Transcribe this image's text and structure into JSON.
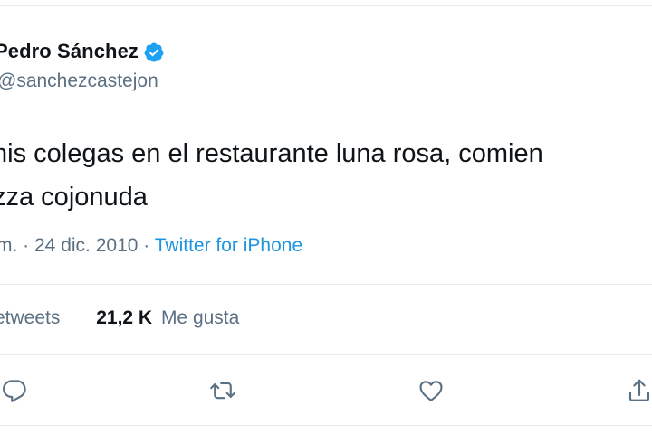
{
  "author": {
    "display_name": "Pedro Sánchez",
    "handle": "@sanchezcastejon",
    "verified": true
  },
  "tweet": {
    "lines": [
      "nis colegas en el restaurante luna rosa, comien",
      "zza cojonuda"
    ]
  },
  "meta": {
    "time": "m.",
    "separator": "·",
    "date": "24 dic. 2010",
    "source": "Twitter for iPhone"
  },
  "stats": {
    "retweets_label": "etweets",
    "likes_count": "21,2 K",
    "likes_label": "Me gusta"
  },
  "actions": {
    "reply_icon": "reply-icon",
    "retweet_icon": "retweet-icon",
    "like_icon": "heart-icon",
    "share_icon": "share-icon"
  },
  "colors": {
    "text": "#0f1419",
    "secondary": "#5b7083",
    "link": "#1b95e0",
    "verified": "#1da1f2",
    "divider": "#e6ecf0"
  }
}
